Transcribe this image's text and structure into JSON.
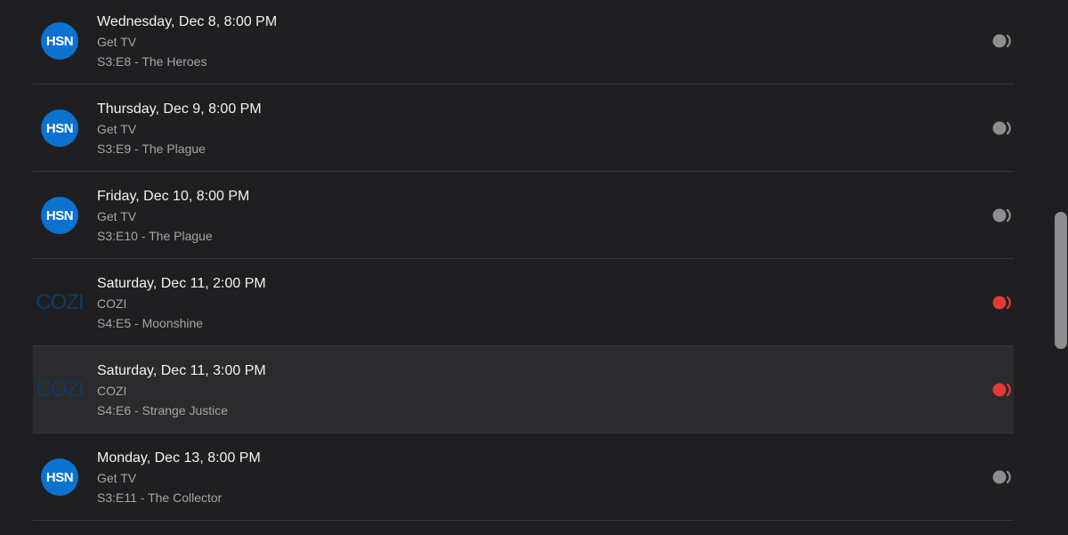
{
  "colors": {
    "background": "#1f1f21",
    "row_highlight": "#2b2b2d",
    "divider": "#38383a",
    "record_inactive": "#8e8e90",
    "record_active": "#e53935",
    "hsn_blue": "#0b72d0",
    "cozi_navy": "#0f3b67"
  },
  "episodes": [
    {
      "date": "Wednesday, Dec 8, 8:00 PM",
      "channel": "Get TV",
      "episode": "S3:E8 - The Heroes",
      "logo": "HSN",
      "record_active": false
    },
    {
      "date": "Thursday, Dec 9, 8:00 PM",
      "channel": "Get TV",
      "episode": "S3:E9 - The Plague",
      "logo": "HSN",
      "record_active": false
    },
    {
      "date": "Friday, Dec 10, 8:00 PM",
      "channel": "Get TV",
      "episode": "S3:E10 - The Plague",
      "logo": "HSN",
      "record_active": false
    },
    {
      "date": "Saturday, Dec 11, 2:00 PM",
      "channel": "COZI",
      "episode": "S4:E5 - Moonshine",
      "logo": "COZI",
      "record_active": true
    },
    {
      "date": "Saturday, Dec 11, 3:00 PM",
      "channel": "COZI",
      "episode": "S4:E6 - Strange Justice",
      "logo": "COZI",
      "record_active": true
    },
    {
      "date": "Monday, Dec 13, 8:00 PM",
      "channel": "Get TV",
      "episode": "S3:E11 - The Collector",
      "logo": "HSN",
      "record_active": false
    }
  ]
}
